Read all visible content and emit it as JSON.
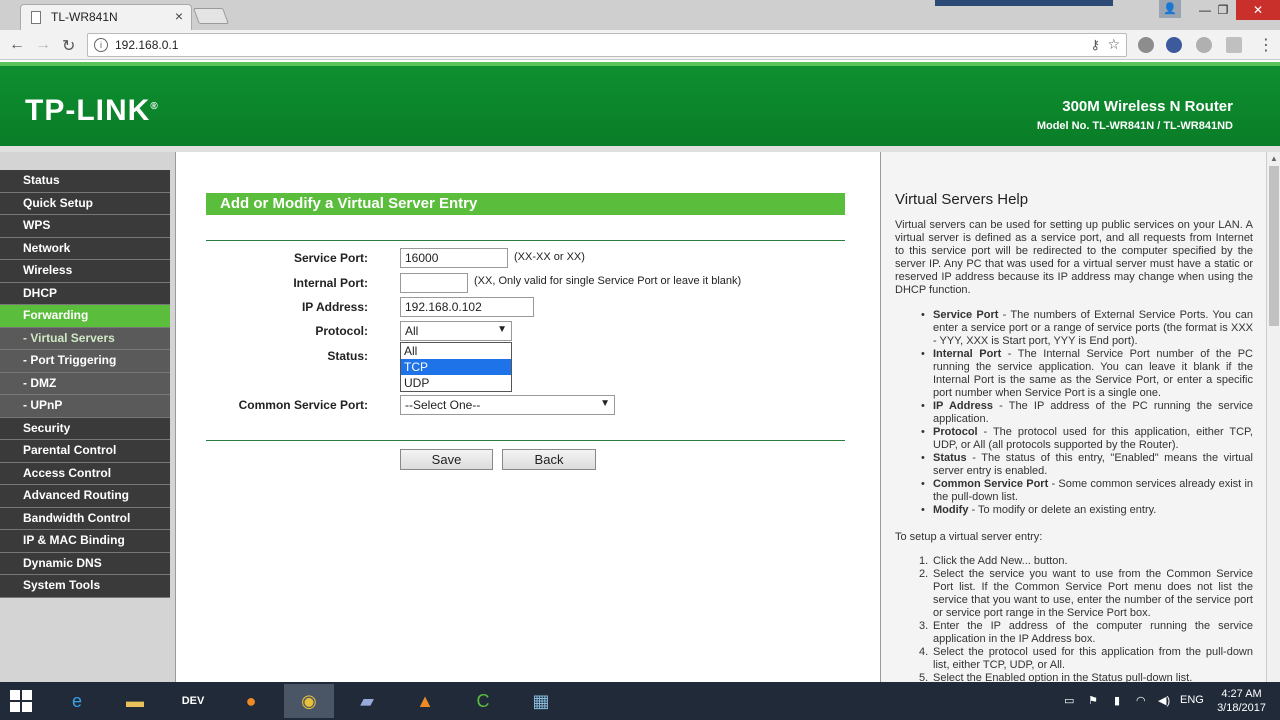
{
  "browser": {
    "tab_title": "TL-WR841N",
    "url": "192.168.0.1"
  },
  "banner": {
    "logo": "TP-LINK",
    "logo_mark": "®",
    "router_name": "300M Wireless N Router",
    "model": "Model No. TL-WR841N / TL-WR841ND"
  },
  "sidebar": {
    "items": [
      {
        "label": "Status"
      },
      {
        "label": "Quick Setup"
      },
      {
        "label": "WPS"
      },
      {
        "label": "Network"
      },
      {
        "label": "Wireless"
      },
      {
        "label": "DHCP"
      },
      {
        "label": "Forwarding",
        "active": true
      },
      {
        "label": "- Virtual Servers",
        "sub": true,
        "active": true
      },
      {
        "label": "- Port Triggering",
        "sub": true
      },
      {
        "label": "- DMZ",
        "sub": true
      },
      {
        "label": "- UPnP",
        "sub": true
      },
      {
        "label": "Security"
      },
      {
        "label": "Parental Control"
      },
      {
        "label": "Access Control"
      },
      {
        "label": "Advanced Routing"
      },
      {
        "label": "Bandwidth Control"
      },
      {
        "label": "IP & MAC Binding"
      },
      {
        "label": "Dynamic DNS"
      },
      {
        "label": "System Tools"
      }
    ]
  },
  "form": {
    "title": "Add or Modify a Virtual Server Entry",
    "service_port_label": "Service Port:",
    "service_port_value": "16000",
    "service_port_hint": "(XX-XX or XX)",
    "internal_port_label": "Internal Port:",
    "internal_port_value": "",
    "internal_port_hint": "(XX, Only valid for single Service Port or leave it blank)",
    "ip_label": "IP Address:",
    "ip_value": "192.168.0.102",
    "protocol_label": "Protocol:",
    "protocol_value": "All",
    "protocol_options": [
      "All",
      "TCP",
      "UDP"
    ],
    "protocol_highlighted": "TCP",
    "status_label": "Status:",
    "common_port_label": "Common Service Port:",
    "common_port_value": "--Select One--",
    "save_label": "Save",
    "back_label": "Back"
  },
  "help": {
    "title": "Virtual Servers Help",
    "intro": "Virtual servers can be used for setting up public services on your LAN. A virtual server is defined as a service port, and all requests from Internet to this service port will be redirected to the computer specified by the server IP. Any PC that was used for a virtual server must have a static or reserved IP address because its IP address may change when using the DHCP function.",
    "bullets": [
      {
        "term": "Service Port",
        "text": " - The numbers of External Service Ports. You can enter a service port or a range of service ports (the format is XXX - YYY, XXX is Start port, YYY is End port)."
      },
      {
        "term": "Internal Port",
        "text": " - The Internal Service Port number of the PC running the service application. You can leave it blank if the Internal Port is the same as the Service Port, or enter a specific port number when Service Port is a single one."
      },
      {
        "term": "IP Address",
        "text": " - The IP address of the PC running the service application."
      },
      {
        "term": "Protocol",
        "text": " - The protocol used for this application, either TCP, UDP, or All (all protocols supported by the Router)."
      },
      {
        "term": "Status",
        "text": " - The status of this entry, \"Enabled\" means the virtual server entry is enabled."
      },
      {
        "term": "Common Service Port",
        "text": " - Some common services already exist in the pull-down list."
      },
      {
        "term": "Modify",
        "text": " - To modify or delete an existing entry."
      }
    ],
    "setup_title": "To setup a virtual server entry:",
    "steps": [
      {
        "num": "1.",
        "text": "Click the Add New... button."
      },
      {
        "num": "2.",
        "text": "Select the service you want to use from the Common Service Port list. If the Common Service Port menu does not list the service that you want to use, enter the number of the service port or service port range in the Service Port box."
      },
      {
        "num": "3.",
        "text": "Enter the IP address of the computer running the service application in the IP Address box."
      },
      {
        "num": "4.",
        "text": "Select the protocol used for this application from the pull-down list, either TCP, UDP, or All."
      },
      {
        "num": "5.",
        "text": "Select the Enabled option in the Status pull-down list."
      }
    ]
  },
  "taskbar": {
    "language": "ENG",
    "time": "4:27 AM",
    "date": "3/18/2017",
    "dev_label": "DEV"
  }
}
